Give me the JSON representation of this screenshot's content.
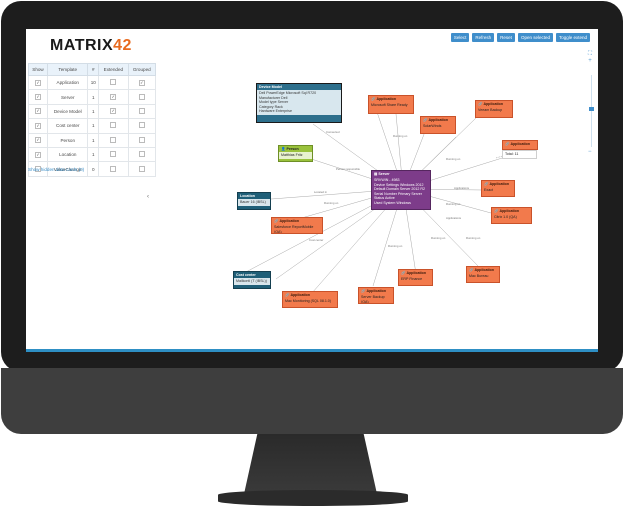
{
  "brand": {
    "prefix": "MATRIX",
    "number": "42"
  },
  "toolbar": [
    "Select",
    "Refresh",
    "Reset",
    "Open selected",
    "Toggle extend"
  ],
  "grid": {
    "headers": [
      "Show",
      "Template",
      "#",
      "Extended",
      "Grouped"
    ],
    "rows": [
      {
        "template": "Application",
        "count": "10"
      },
      {
        "template": "Server",
        "count": "1"
      },
      {
        "template": "Device Model",
        "count": "1"
      },
      {
        "template": "Cost center",
        "count": "1"
      },
      {
        "template": "Person",
        "count": "1"
      },
      {
        "template": "Location",
        "count": "1"
      },
      {
        "template": "ValueChange",
        "count": "0"
      }
    ]
  },
  "show_hidden": "Show hidden data cards (0)",
  "zoom": {
    "plus": "+",
    "minus": "−"
  },
  "nodes": {
    "server": {
      "title": "Server",
      "name": "SRVWIN - 4983",
      "lines": [
        "Device Settings   Windows 2012",
        "Default Domain    Server 2012 R2",
        "Serial Number     Primary Server",
        "Status            Active",
        "Used System       Windows",
        "Public IP         192.168.0.14"
      ]
    },
    "device_model": {
      "title": "Device Model",
      "name": "Dell PowerEdge Microsoft Sql R720",
      "lines": [
        "Manufacturer   Dell",
        "Model type     Server",
        "Category       Rack",
        "Hardware       Enterprise"
      ]
    },
    "person": {
      "title": "Person",
      "name": "Matthias Fritz"
    },
    "location": {
      "title": "Location",
      "name": "Bauer 16 (IBSL)"
    },
    "cost_center": {
      "title": "Cost center",
      "name": "Mailkontl (T (IBSL))"
    },
    "total": {
      "name": "Total: 11"
    },
    "apps": [
      {
        "title": "Application",
        "name": "Microsoft Share Ready"
      },
      {
        "title": "Application",
        "name": "SolarWinds"
      },
      {
        "title": "Application",
        "name": "Veeam Backup"
      },
      {
        "title": "Application",
        "name": "Total 11"
      },
      {
        "title": "Application",
        "name": "Exact"
      },
      {
        "title": "Application",
        "name": "Citrix 1.0 (QA)"
      },
      {
        "title": "Application",
        "name": "Salesforce ReportMobile (QA)"
      },
      {
        "title": "Application",
        "name": "Server Backup (QA)"
      },
      {
        "title": "Application",
        "name": "ERP Finance"
      },
      {
        "title": "Application",
        "name": "Mac Bureau"
      },
      {
        "title": "Application",
        "name": "Mac Monitoring (SQL 08.1.0)"
      }
    ]
  },
  "colors": {
    "accent": "#3f8ecb",
    "application": "#f27a4c",
    "server": "#7d3c8a",
    "location": "#1f5f78",
    "person": "#9ac23c"
  }
}
